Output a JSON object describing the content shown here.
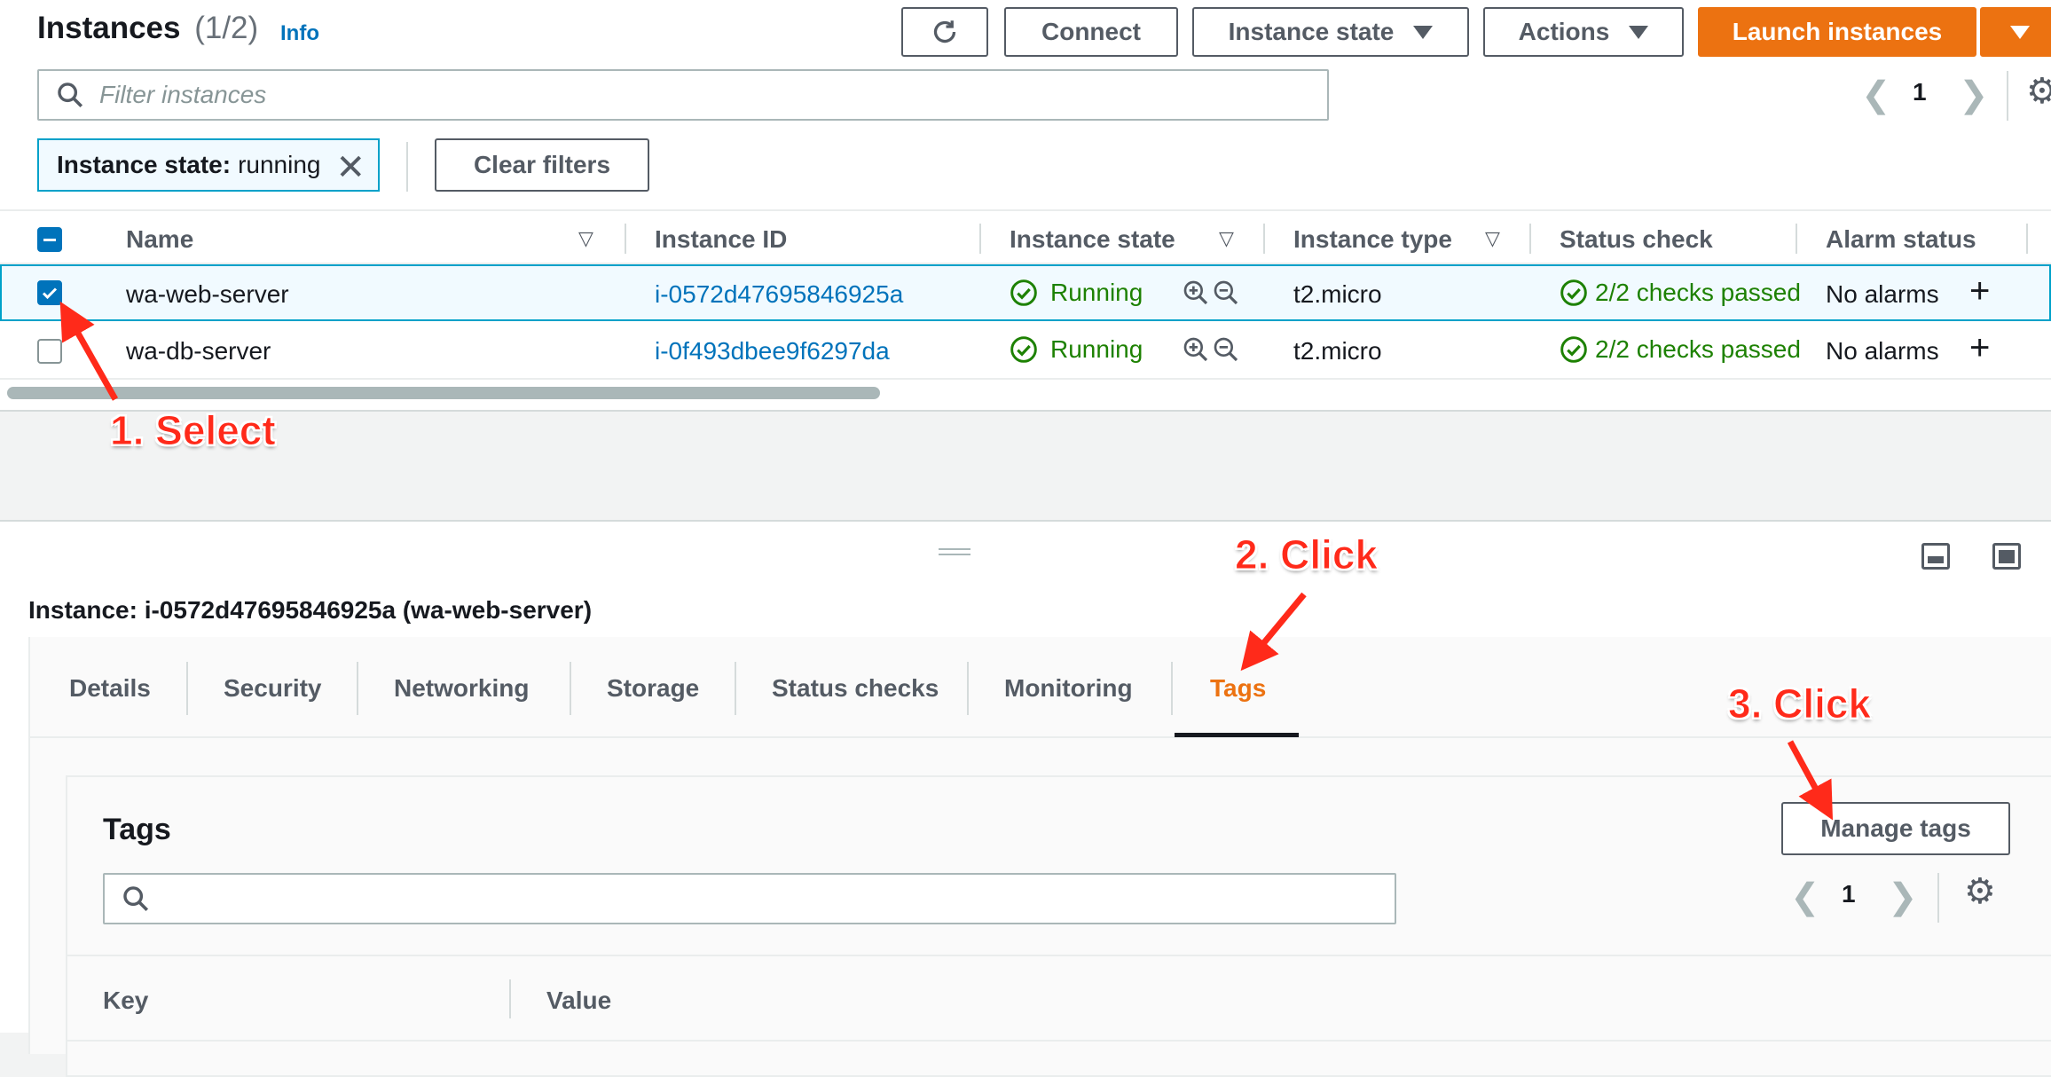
{
  "header": {
    "title": "Instances",
    "count": "(1/2)",
    "info": "Info",
    "connect_label": "Connect",
    "instance_state_label": "Instance state",
    "actions_label": "Actions",
    "launch_label": "Launch instances"
  },
  "filter": {
    "placeholder": "Filter instances",
    "page": "1",
    "chip_key": "Instance state:",
    "chip_value": "running",
    "clear_label": "Clear filters"
  },
  "table": {
    "columns": [
      "Name",
      "Instance ID",
      "Instance state",
      "Instance type",
      "Status check",
      "Alarm status"
    ],
    "rows": [
      {
        "name": "wa-web-server",
        "id": "i-0572d47695846925a",
        "state": "Running",
        "type": "t2.micro",
        "status": "2/2 checks passed",
        "alarm": "No alarms",
        "selected": true
      },
      {
        "name": "wa-db-server",
        "id": "i-0f493dbee9f6297da",
        "state": "Running",
        "type": "t2.micro",
        "status": "2/2 checks passed",
        "alarm": "No alarms",
        "selected": false
      }
    ]
  },
  "details": {
    "title": "Instance: i-0572d47695846925a (wa-web-server)",
    "tabs": [
      "Details",
      "Security",
      "Networking",
      "Storage",
      "Status checks",
      "Monitoring",
      "Tags"
    ],
    "active_tab": "Tags"
  },
  "tags_panel": {
    "title": "Tags",
    "manage_label": "Manage tags",
    "page": "1",
    "col_key": "Key",
    "col_value": "Value"
  },
  "annotations": {
    "step1": "1. Select",
    "step2": "2. Click",
    "step3": "3. Click"
  },
  "colors": {
    "primary": "#ec7211",
    "link": "#0073bb",
    "success": "#1d8102",
    "annotation": "#ff2a1a"
  }
}
